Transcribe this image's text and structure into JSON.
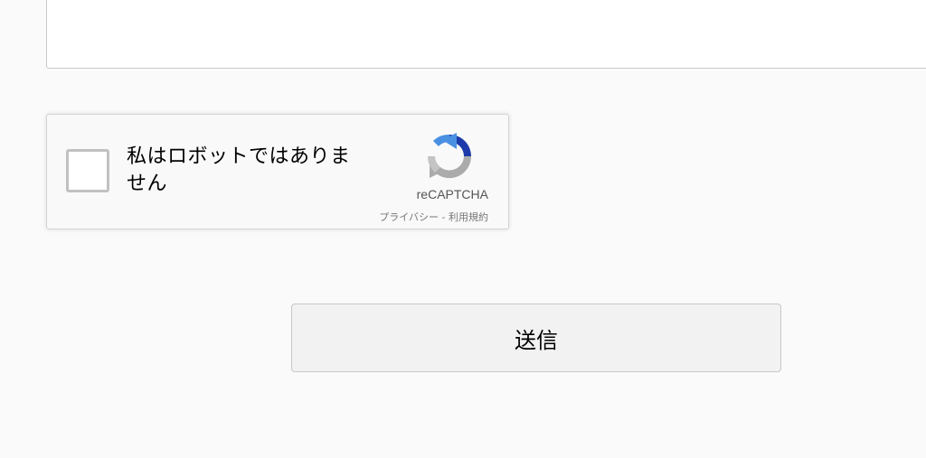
{
  "form": {
    "message_value": "",
    "submit_label": "送信"
  },
  "recaptcha": {
    "checkbox_checked": false,
    "label": "私はロボットではありません",
    "brand": "reCAPTCHA",
    "privacy_link": "プライバシー",
    "separator": " - ",
    "terms_link": "利用規約",
    "logo_icon": "recaptcha-logo-icon",
    "colors": {
      "blue_dark": "#1c3aa9",
      "blue_light": "#4a90e2",
      "gray": "#ababab"
    }
  }
}
